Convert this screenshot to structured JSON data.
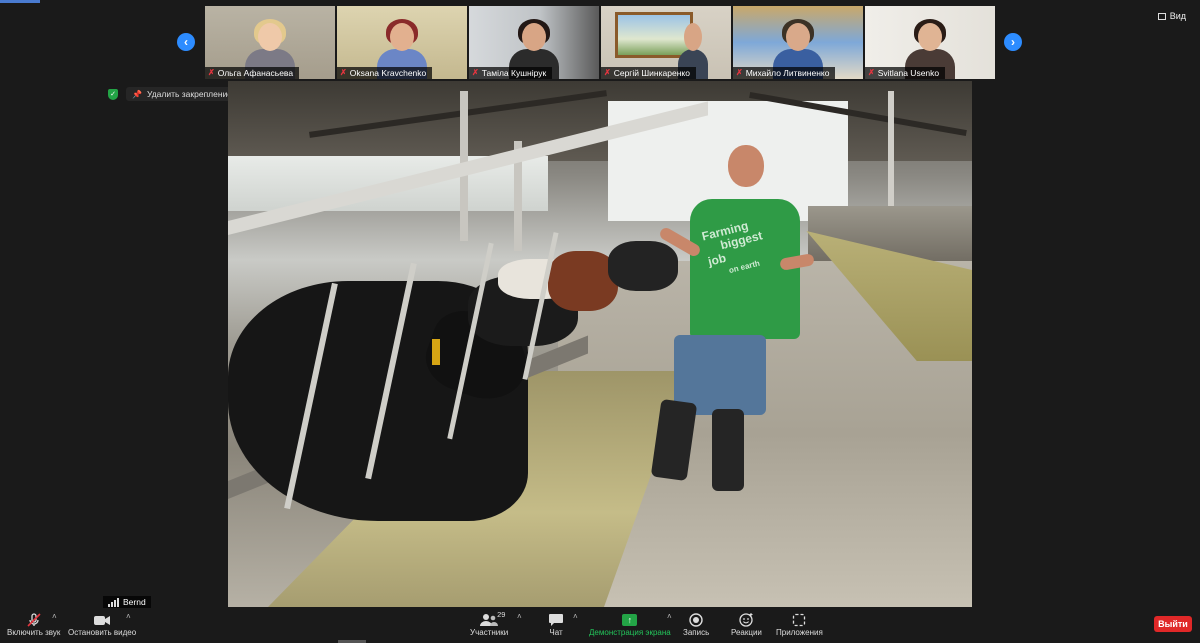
{
  "app": {
    "view_label": "Вид",
    "unpin_label": "Удалить закрепление",
    "active_speaker": "Bernd"
  },
  "participants": [
    {
      "name": "Ольга Афанасьева",
      "muted": true
    },
    {
      "name": "Oksana Kravchenko",
      "muted": true
    },
    {
      "name": "Тамiла Кушнiрук",
      "muted": true
    },
    {
      "name": "Сергiй Шинкаренко",
      "muted": true
    },
    {
      "name": "Михайло Литвиненко",
      "muted": true
    },
    {
      "name": "Svitlana Usenko",
      "muted": true
    }
  ],
  "main_video": {
    "shirt_text_1": "Farming",
    "shirt_text_2": "biggest",
    "shirt_text_3": "job",
    "shirt_text_4": "on earth"
  },
  "toolbar": {
    "unmute": "Включить звук",
    "stop_video": "Остановить видео",
    "participants": "Участники",
    "participants_count": "29",
    "chat": "Чат",
    "share_screen": "Демонстрация экрана",
    "record": "Запись",
    "reactions": "Реакции",
    "apps": "Приложения",
    "leave": "Выйти"
  },
  "colors": {
    "accent": "#2d8cff",
    "share_green": "#23a446",
    "leave_red": "#e02828",
    "mute_red": "#e5353f"
  }
}
